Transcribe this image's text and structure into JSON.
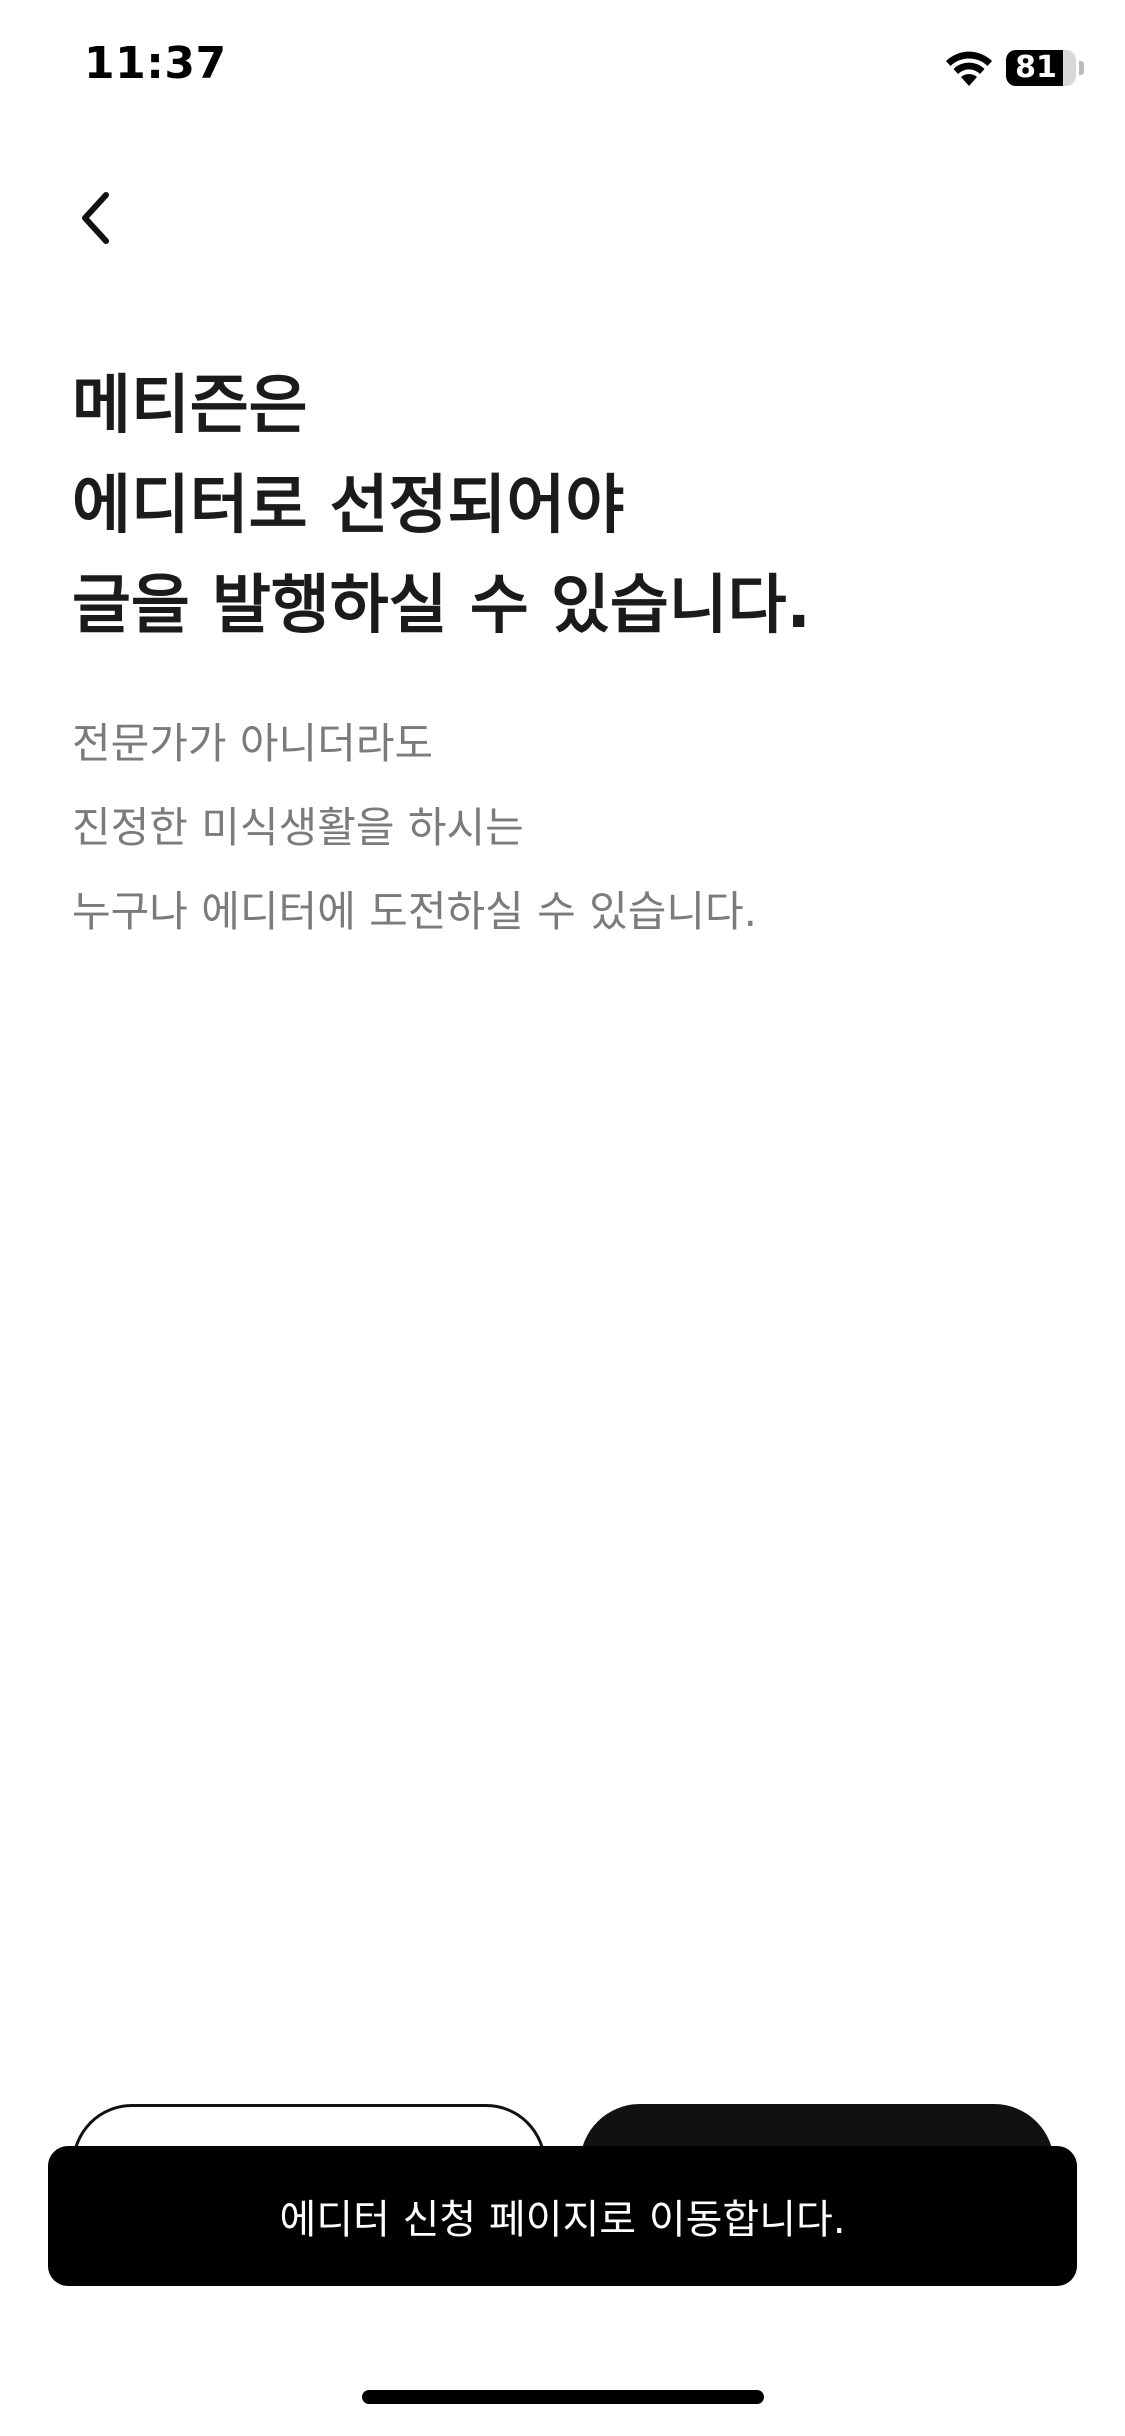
{
  "status_bar": {
    "time": "11:37",
    "battery_level": "81",
    "battery_fraction": 0.81
  },
  "nav": {
    "back_icon": "chevron-left-icon"
  },
  "headline": {
    "lines": [
      "메티즌은",
      "에디터로 선정되어야",
      "글을 발행하실 수 있습니다."
    ]
  },
  "description": {
    "lines": [
      "전문가가 아니더라도",
      "진정한 미식생활을 하시는",
      "누구나 에디터에 도전하실 수 있습니다."
    ]
  },
  "toast": {
    "message": "에디터 신청 페이지로 이동합니다."
  },
  "colors": {
    "primary": "#111111",
    "text": "#1b1b1b",
    "muted": "#7b7b7b",
    "background": "#ffffff"
  }
}
